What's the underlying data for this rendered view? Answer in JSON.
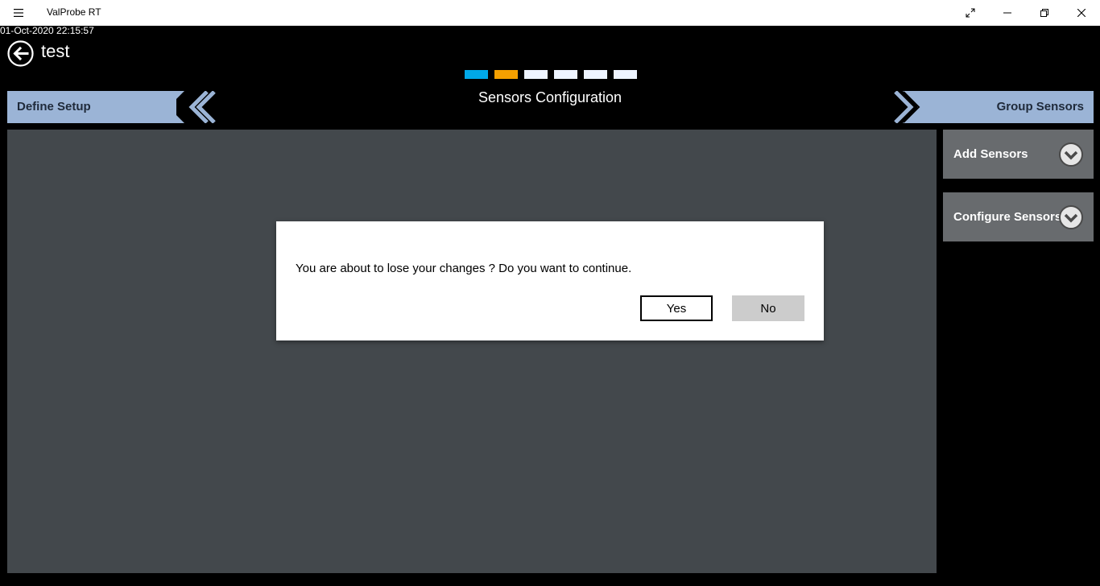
{
  "window": {
    "title": "ValProbe RT",
    "icons": {
      "menu": "hamburger-icon",
      "fullscreen": "expand-icon",
      "minimize": "minimize-icon",
      "restore": "restore-icon",
      "close": "close-icon"
    }
  },
  "header": {
    "timestamp": "01-Oct-2020 22:15:57",
    "page_title": "test",
    "back_icon": "back-arrow-icon"
  },
  "wizard": {
    "section_title": "Sensors Configuration",
    "steps": [
      {
        "state": "completed",
        "color": "#00a8e8"
      },
      {
        "state": "current",
        "color": "#f5a000"
      },
      {
        "state": "pending",
        "color": "#eef4ff"
      },
      {
        "state": "pending",
        "color": "#eef4ff"
      },
      {
        "state": "pending",
        "color": "#eef4ff"
      },
      {
        "state": "pending",
        "color": "#eef4ff"
      }
    ],
    "prev_label": "Define Setup",
    "next_label": "Group Sensors",
    "nav_color": "#9bb4d6"
  },
  "side_panel": {
    "items": [
      {
        "label": "Add Sensors",
        "icon": "chevron-down-icon"
      },
      {
        "label": "Configure Sensors",
        "icon": "chevron-down-icon"
      }
    ]
  },
  "dialog": {
    "message": "You are about to lose your changes ? Do you want to continue.",
    "yes_label": "Yes",
    "no_label": "No"
  }
}
